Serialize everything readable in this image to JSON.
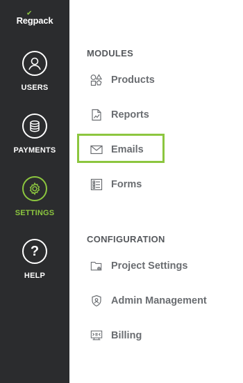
{
  "logo": {
    "text": "Regpack"
  },
  "sidebar": {
    "items": [
      {
        "label": "USERS",
        "icon": "user-icon",
        "active": false
      },
      {
        "label": "PAYMENTS",
        "icon": "coins-icon",
        "active": false
      },
      {
        "label": "SETTINGS",
        "icon": "gear-icon",
        "active": true
      },
      {
        "label": "HELP",
        "icon": "question-icon",
        "active": false
      }
    ]
  },
  "modules": {
    "title": "MODULES",
    "items": [
      {
        "label": "Products",
        "icon": "shapes-icon"
      },
      {
        "label": "Reports",
        "icon": "chart-doc-icon"
      },
      {
        "label": "Emails",
        "icon": "envelope-icon",
        "highlighted": true
      },
      {
        "label": "Forms",
        "icon": "form-list-icon"
      }
    ]
  },
  "configuration": {
    "title": "CONFIGURATION",
    "items": [
      {
        "label": "Project Settings",
        "icon": "folder-gear-icon"
      },
      {
        "label": "Admin Management",
        "icon": "shield-icon"
      },
      {
        "label": "Billing",
        "icon": "billing-icon"
      }
    ]
  },
  "colors": {
    "sidebar_bg": "#2b2c2e",
    "accent": "#8cc63f",
    "text": "#6a6d71"
  }
}
